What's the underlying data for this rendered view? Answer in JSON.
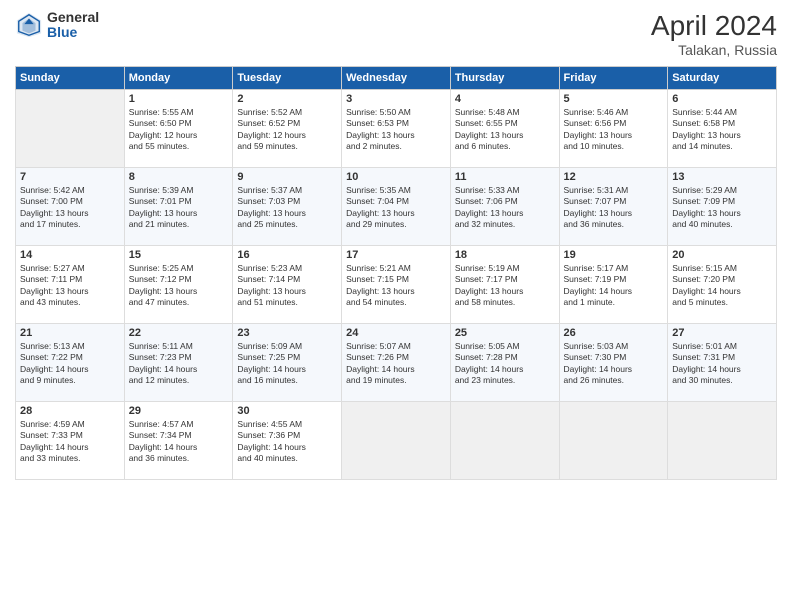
{
  "header": {
    "logo_general": "General",
    "logo_blue": "Blue",
    "title": "April 2024",
    "subtitle": "Talakan, Russia"
  },
  "columns": [
    "Sunday",
    "Monday",
    "Tuesday",
    "Wednesday",
    "Thursday",
    "Friday",
    "Saturday"
  ],
  "weeks": [
    [
      {
        "day": "",
        "info": ""
      },
      {
        "day": "1",
        "info": "Sunrise: 5:55 AM\nSunset: 6:50 PM\nDaylight: 12 hours\nand 55 minutes."
      },
      {
        "day": "2",
        "info": "Sunrise: 5:52 AM\nSunset: 6:52 PM\nDaylight: 12 hours\nand 59 minutes."
      },
      {
        "day": "3",
        "info": "Sunrise: 5:50 AM\nSunset: 6:53 PM\nDaylight: 13 hours\nand 2 minutes."
      },
      {
        "day": "4",
        "info": "Sunrise: 5:48 AM\nSunset: 6:55 PM\nDaylight: 13 hours\nand 6 minutes."
      },
      {
        "day": "5",
        "info": "Sunrise: 5:46 AM\nSunset: 6:56 PM\nDaylight: 13 hours\nand 10 minutes."
      },
      {
        "day": "6",
        "info": "Sunrise: 5:44 AM\nSunset: 6:58 PM\nDaylight: 13 hours\nand 14 minutes."
      }
    ],
    [
      {
        "day": "7",
        "info": "Sunrise: 5:42 AM\nSunset: 7:00 PM\nDaylight: 13 hours\nand 17 minutes."
      },
      {
        "day": "8",
        "info": "Sunrise: 5:39 AM\nSunset: 7:01 PM\nDaylight: 13 hours\nand 21 minutes."
      },
      {
        "day": "9",
        "info": "Sunrise: 5:37 AM\nSunset: 7:03 PM\nDaylight: 13 hours\nand 25 minutes."
      },
      {
        "day": "10",
        "info": "Sunrise: 5:35 AM\nSunset: 7:04 PM\nDaylight: 13 hours\nand 29 minutes."
      },
      {
        "day": "11",
        "info": "Sunrise: 5:33 AM\nSunset: 7:06 PM\nDaylight: 13 hours\nand 32 minutes."
      },
      {
        "day": "12",
        "info": "Sunrise: 5:31 AM\nSunset: 7:07 PM\nDaylight: 13 hours\nand 36 minutes."
      },
      {
        "day": "13",
        "info": "Sunrise: 5:29 AM\nSunset: 7:09 PM\nDaylight: 13 hours\nand 40 minutes."
      }
    ],
    [
      {
        "day": "14",
        "info": "Sunrise: 5:27 AM\nSunset: 7:11 PM\nDaylight: 13 hours\nand 43 minutes."
      },
      {
        "day": "15",
        "info": "Sunrise: 5:25 AM\nSunset: 7:12 PM\nDaylight: 13 hours\nand 47 minutes."
      },
      {
        "day": "16",
        "info": "Sunrise: 5:23 AM\nSunset: 7:14 PM\nDaylight: 13 hours\nand 51 minutes."
      },
      {
        "day": "17",
        "info": "Sunrise: 5:21 AM\nSunset: 7:15 PM\nDaylight: 13 hours\nand 54 minutes."
      },
      {
        "day": "18",
        "info": "Sunrise: 5:19 AM\nSunset: 7:17 PM\nDaylight: 13 hours\nand 58 minutes."
      },
      {
        "day": "19",
        "info": "Sunrise: 5:17 AM\nSunset: 7:19 PM\nDaylight: 14 hours\nand 1 minute."
      },
      {
        "day": "20",
        "info": "Sunrise: 5:15 AM\nSunset: 7:20 PM\nDaylight: 14 hours\nand 5 minutes."
      }
    ],
    [
      {
        "day": "21",
        "info": "Sunrise: 5:13 AM\nSunset: 7:22 PM\nDaylight: 14 hours\nand 9 minutes."
      },
      {
        "day": "22",
        "info": "Sunrise: 5:11 AM\nSunset: 7:23 PM\nDaylight: 14 hours\nand 12 minutes."
      },
      {
        "day": "23",
        "info": "Sunrise: 5:09 AM\nSunset: 7:25 PM\nDaylight: 14 hours\nand 16 minutes."
      },
      {
        "day": "24",
        "info": "Sunrise: 5:07 AM\nSunset: 7:26 PM\nDaylight: 14 hours\nand 19 minutes."
      },
      {
        "day": "25",
        "info": "Sunrise: 5:05 AM\nSunset: 7:28 PM\nDaylight: 14 hours\nand 23 minutes."
      },
      {
        "day": "26",
        "info": "Sunrise: 5:03 AM\nSunset: 7:30 PM\nDaylight: 14 hours\nand 26 minutes."
      },
      {
        "day": "27",
        "info": "Sunrise: 5:01 AM\nSunset: 7:31 PM\nDaylight: 14 hours\nand 30 minutes."
      }
    ],
    [
      {
        "day": "28",
        "info": "Sunrise: 4:59 AM\nSunset: 7:33 PM\nDaylight: 14 hours\nand 33 minutes."
      },
      {
        "day": "29",
        "info": "Sunrise: 4:57 AM\nSunset: 7:34 PM\nDaylight: 14 hours\nand 36 minutes."
      },
      {
        "day": "30",
        "info": "Sunrise: 4:55 AM\nSunset: 7:36 PM\nDaylight: 14 hours\nand 40 minutes."
      },
      {
        "day": "",
        "info": ""
      },
      {
        "day": "",
        "info": ""
      },
      {
        "day": "",
        "info": ""
      },
      {
        "day": "",
        "info": ""
      }
    ]
  ]
}
